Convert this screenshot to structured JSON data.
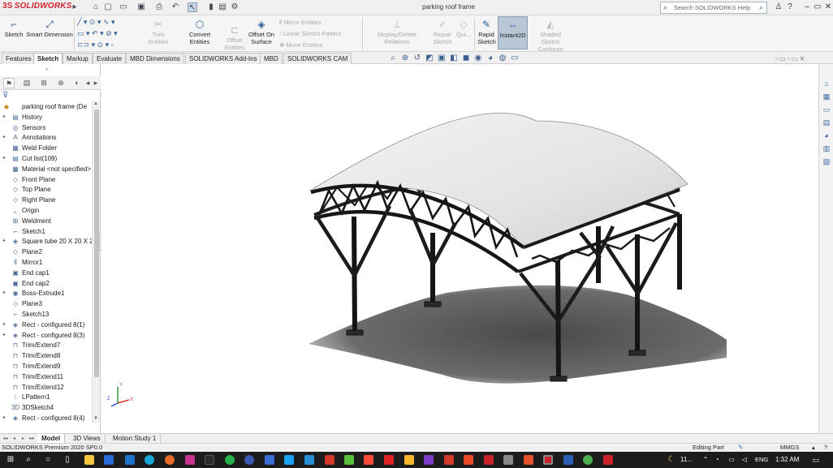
{
  "app": {
    "brand": "SOLIDWORKS",
    "brand_prefix": "3S",
    "document_title": "parking roof frame"
  },
  "search": {
    "placeholder": "Search SOLIDWORKS Help"
  },
  "command_manager": {
    "sketch": "Sketch",
    "smart_dimension": "Smart Dimension",
    "trim_entities": "Trim Entities",
    "convert_entities": "Convert Entities",
    "offset_entities": "Offset Entities",
    "offset_on_surface": "Offset On Surface",
    "mirror_entities": "Mirror Entities",
    "linear_sketch_pattern": "Linear Sketch Pattern",
    "move_entities": "Move Entities",
    "display_delete_relations": "Display/Delete Relations",
    "repair_sketch": "Repair Sketch",
    "quick_snaps": "Qui...",
    "rapid_sketch": "Rapid Sketch",
    "instant2d": "Instant2D",
    "shaded_sketch_contours": "Shaded Sketch Contours"
  },
  "tabs": [
    {
      "label": "Features"
    },
    {
      "label": "Sketch"
    },
    {
      "label": "Markup"
    },
    {
      "label": "Evaluate"
    },
    {
      "label": "MBD Dimensions"
    },
    {
      "label": "SOLIDWORKS Add-Ins"
    },
    {
      "label": "MBD"
    },
    {
      "label": "SOLIDWORKS CAM"
    }
  ],
  "feature_tree": {
    "root": "parking roof frame  (De",
    "items": [
      {
        "label": "History",
        "icon": "history-icon",
        "expandable": true
      },
      {
        "label": "Sensors",
        "icon": "sensor-icon",
        "expandable": false
      },
      {
        "label": "Annotations",
        "icon": "annotation-icon",
        "expandable": true
      },
      {
        "label": "Weld Folder",
        "icon": "weld-folder-icon",
        "expandable": false
      },
      {
        "label": "Cut list(109)",
        "icon": "cut-list-icon",
        "expandable": true
      },
      {
        "label": "Material <not specified>",
        "icon": "material-icon",
        "expandable": false
      },
      {
        "label": "Front Plane",
        "icon": "plane-icon",
        "expandable": false
      },
      {
        "label": "Top Plane",
        "icon": "plane-icon",
        "expandable": false
      },
      {
        "label": "Right Plane",
        "icon": "plane-icon",
        "expandable": false
      },
      {
        "label": "Origin",
        "icon": "origin-icon",
        "expandable": false
      },
      {
        "label": "Weldment",
        "icon": "weldment-icon",
        "expandable": false
      },
      {
        "label": "Sketch1",
        "icon": "sketch-icon",
        "expandable": false
      },
      {
        "label": "Square tube 20 X 20 X 2",
        "icon": "structural-member-icon",
        "expandable": true
      },
      {
        "label": "Plane2",
        "icon": "plane-icon",
        "expandable": false
      },
      {
        "label": "Mirror1",
        "icon": "mirror-icon",
        "expandable": false
      },
      {
        "label": "End cap1",
        "icon": "end-cap-icon",
        "expandable": false
      },
      {
        "label": "End cap2",
        "icon": "end-cap-icon",
        "expandable": false
      },
      {
        "label": "Boss-Extrude1",
        "icon": "extrude-icon",
        "expandable": true
      },
      {
        "label": "Plane3",
        "icon": "plane-icon",
        "expandable": false
      },
      {
        "label": "Sketch13",
        "icon": "sketch-icon",
        "expandable": false
      },
      {
        "label": "Rect - configured 8(1)",
        "icon": "structural-member-icon",
        "expandable": true
      },
      {
        "label": "Rect - configured 8(3)",
        "icon": "structural-member-icon",
        "expandable": true
      },
      {
        "label": "Trim/Extend7",
        "icon": "trim-extend-icon",
        "expandable": false
      },
      {
        "label": "Trim/Extend8",
        "icon": "trim-extend-icon",
        "expandable": false
      },
      {
        "label": "Trim/Extend9",
        "icon": "trim-extend-icon",
        "expandable": false
      },
      {
        "label": "Trim/Extend11",
        "icon": "trim-extend-icon",
        "expandable": false
      },
      {
        "label": "Trim/Extend12",
        "icon": "trim-extend-icon",
        "expandable": false
      },
      {
        "label": "LPattern1",
        "icon": "pattern-icon",
        "expandable": false
      },
      {
        "label": "3DSketch4",
        "icon": "3d-sketch-icon",
        "expandable": false
      },
      {
        "label": "Rect - configured 8(4)",
        "icon": "structural-member-icon",
        "expandable": true
      }
    ]
  },
  "triad": {
    "x": "X",
    "y": "Y",
    "z": "Z"
  },
  "bottom_tabs": [
    {
      "label": "Model"
    },
    {
      "label": "3D Views"
    },
    {
      "label": "Motion Study 1"
    }
  ],
  "status": {
    "version": "SOLIDWORKS Premium 2020 SP0.0",
    "mode": "Editing Part",
    "units": "MMGS"
  },
  "system_tray": {
    "temperature": "11...",
    "language": "ENG",
    "time": "1:32 AM"
  },
  "colors": {
    "brand_red": "#d1232a",
    "accent_blue": "#2d5f9a",
    "frame_dark": "#1e1e1e",
    "roof_gray": "#e2e2e2",
    "shadow": "#5a5a5a"
  }
}
